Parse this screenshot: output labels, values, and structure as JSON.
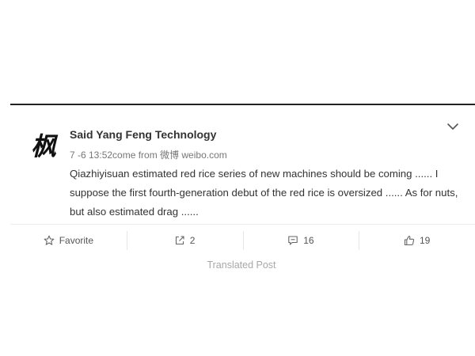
{
  "post": {
    "author": "Said Yang Feng Technology",
    "avatar_glyph": "枫",
    "meta": {
      "time": "7 -6 13:52",
      "source": "come from 微博 weibo.com"
    },
    "text": "Qiazhiyisuan estimated red rice series of new machines should be coming ...... I suppose the first fourth-generation debut of the red rice is oversized ...... As for nuts, but also estimated drag ......",
    "expand_icon": "chevron-down-icon"
  },
  "actions": {
    "favorite": {
      "label": "Favorite",
      "icon": "star-icon"
    },
    "repost": {
      "count": "2",
      "icon": "share-icon"
    },
    "comment": {
      "count": "16",
      "icon": "comment-icon"
    },
    "like": {
      "count": "19",
      "icon": "thumbs-up-icon"
    }
  },
  "translated_label": "Translated Post"
}
